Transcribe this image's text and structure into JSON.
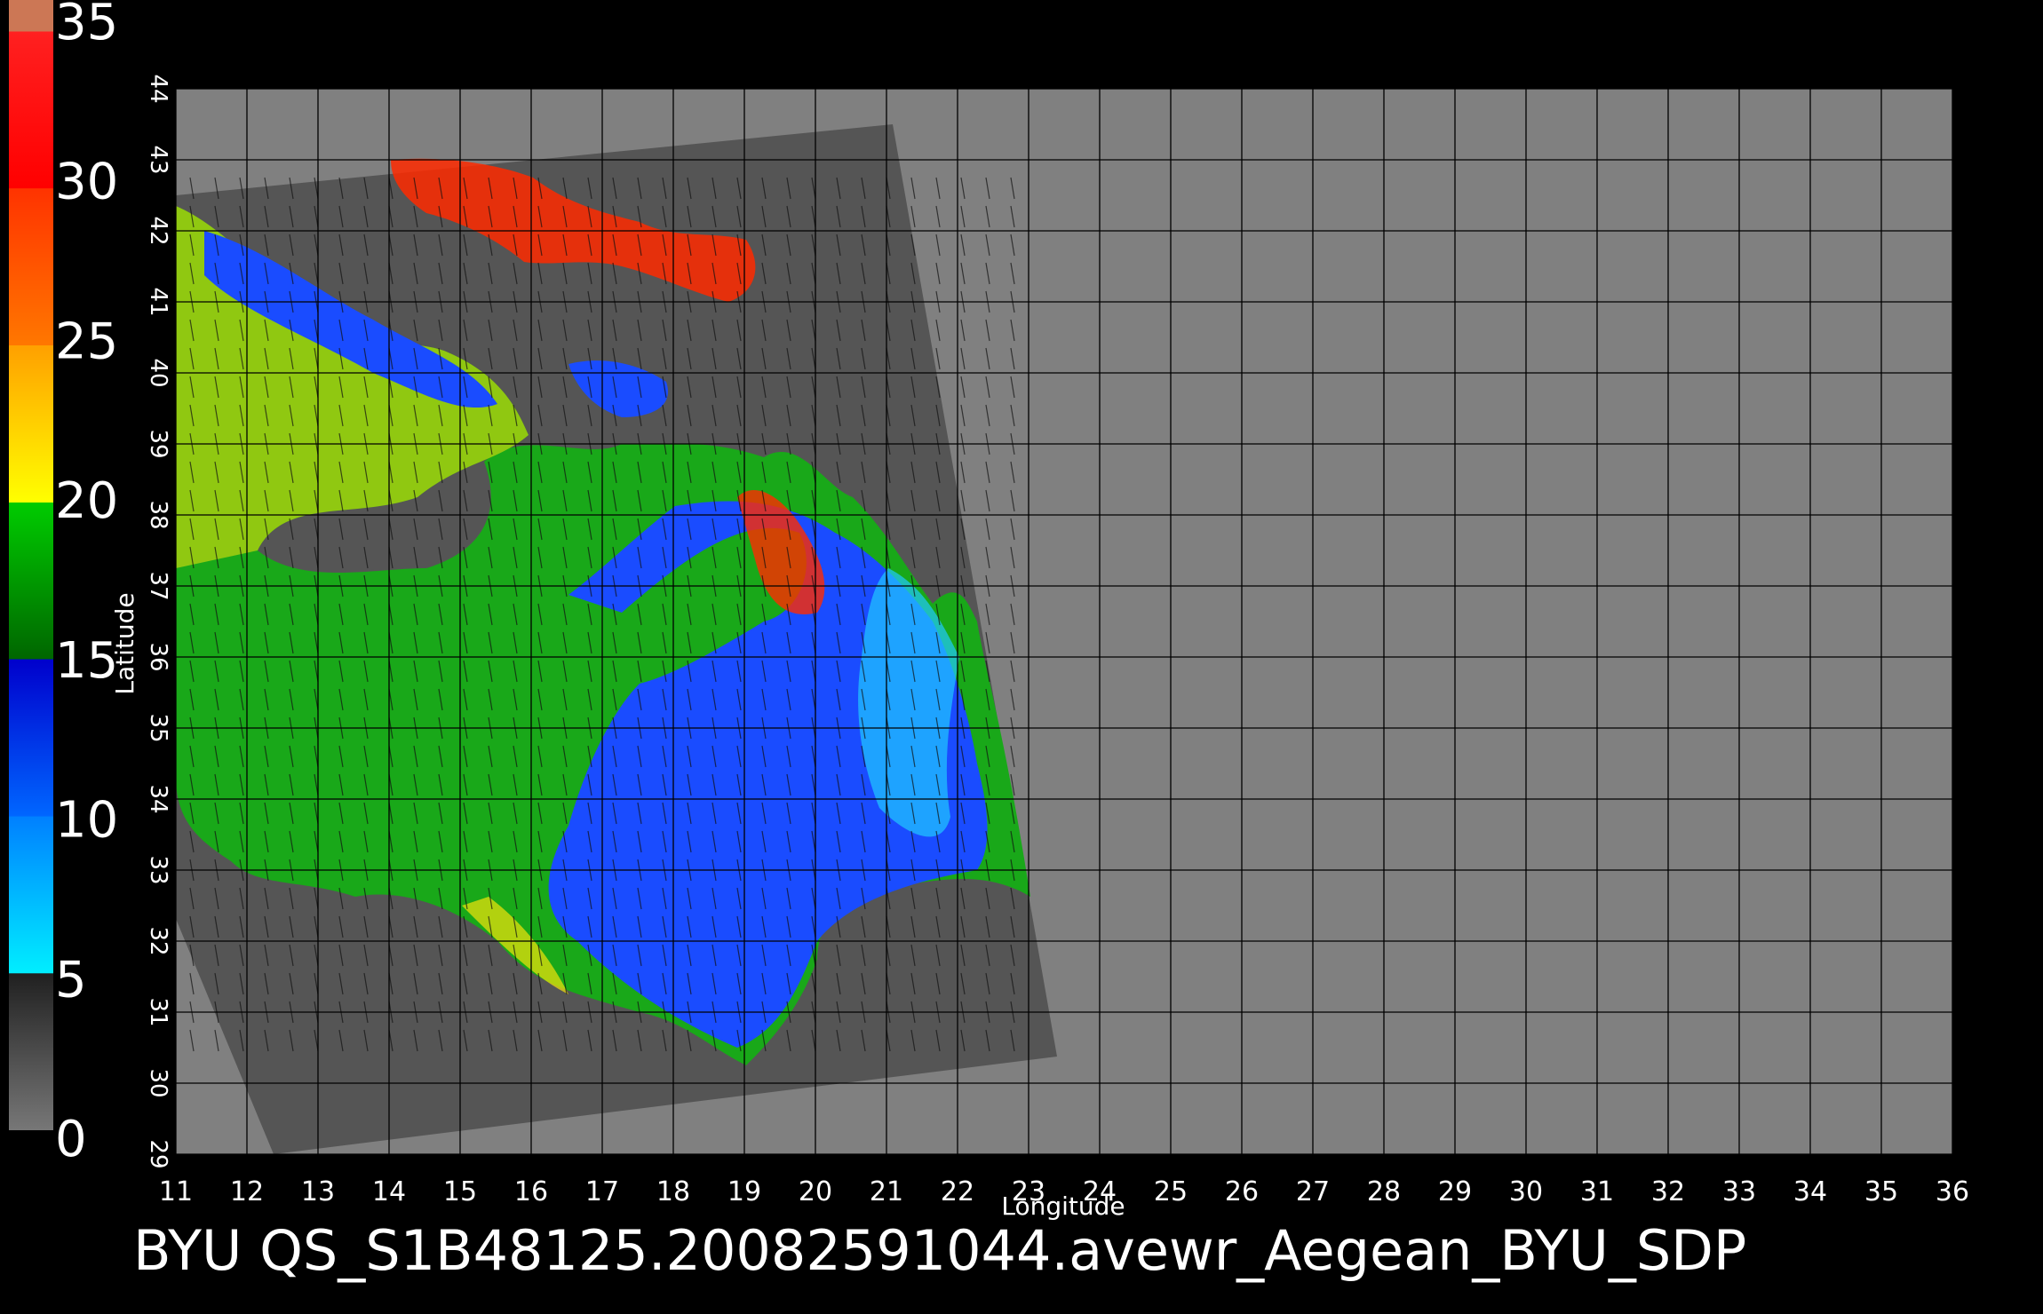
{
  "colorbar": {
    "labels": [
      "35",
      "30",
      "25",
      "20",
      "15",
      "10",
      "5",
      "0"
    ],
    "stops": [
      {
        "from": 0,
        "to": 5,
        "colors": [
          "#777777",
          "#202020"
        ]
      },
      {
        "from": 5,
        "to": 10,
        "colors": [
          "#00eeff",
          "#0080ff"
        ]
      },
      {
        "from": 10,
        "to": 15,
        "colors": [
          "#0066ff",
          "#0000cc"
        ]
      },
      {
        "from": 15,
        "to": 20,
        "colors": [
          "#006600",
          "#00cc00"
        ]
      },
      {
        "from": 20,
        "to": 25,
        "colors": [
          "#ffff00",
          "#ffa000"
        ]
      },
      {
        "from": 25,
        "to": 30,
        "colors": [
          "#ff7700",
          "#ff3300"
        ]
      },
      {
        "from": 30,
        "to": 35,
        "colors": [
          "#ff0000",
          "#ff2020"
        ]
      },
      {
        "from": 35,
        "to": 36,
        "colors": [
          "#cc7755",
          "#cc7755"
        ]
      }
    ]
  },
  "map": {
    "x_label": "Longitude",
    "y_label": "Latitude",
    "lon_ticks": [
      "11",
      "12",
      "13",
      "14",
      "15",
      "16",
      "17",
      "18",
      "19",
      "20",
      "21",
      "22",
      "23",
      "24",
      "25",
      "26",
      "27",
      "28",
      "29",
      "30",
      "31",
      "32",
      "33",
      "34",
      "35",
      "36"
    ],
    "lat_ticks": [
      "29",
      "30",
      "31",
      "32",
      "33",
      "34",
      "35",
      "36",
      "37",
      "38",
      "39",
      "40",
      "41",
      "42",
      "43",
      "44"
    ],
    "lon_range": [
      11,
      36
    ],
    "lat_range": [
      29,
      44
    ],
    "grid": true,
    "background_color": "#808080",
    "swath_color": "#555555",
    "colors": {
      "blue": "#1a4cff",
      "green": "#19a819",
      "yellow": "#f3e20b",
      "red": "#ff2a00",
      "cyan": "#21c9ff"
    }
  },
  "footer": {
    "caption": "BYU  QS_S1B48125.20082591044.avewr_Aegean_BYU_SDP"
  }
}
